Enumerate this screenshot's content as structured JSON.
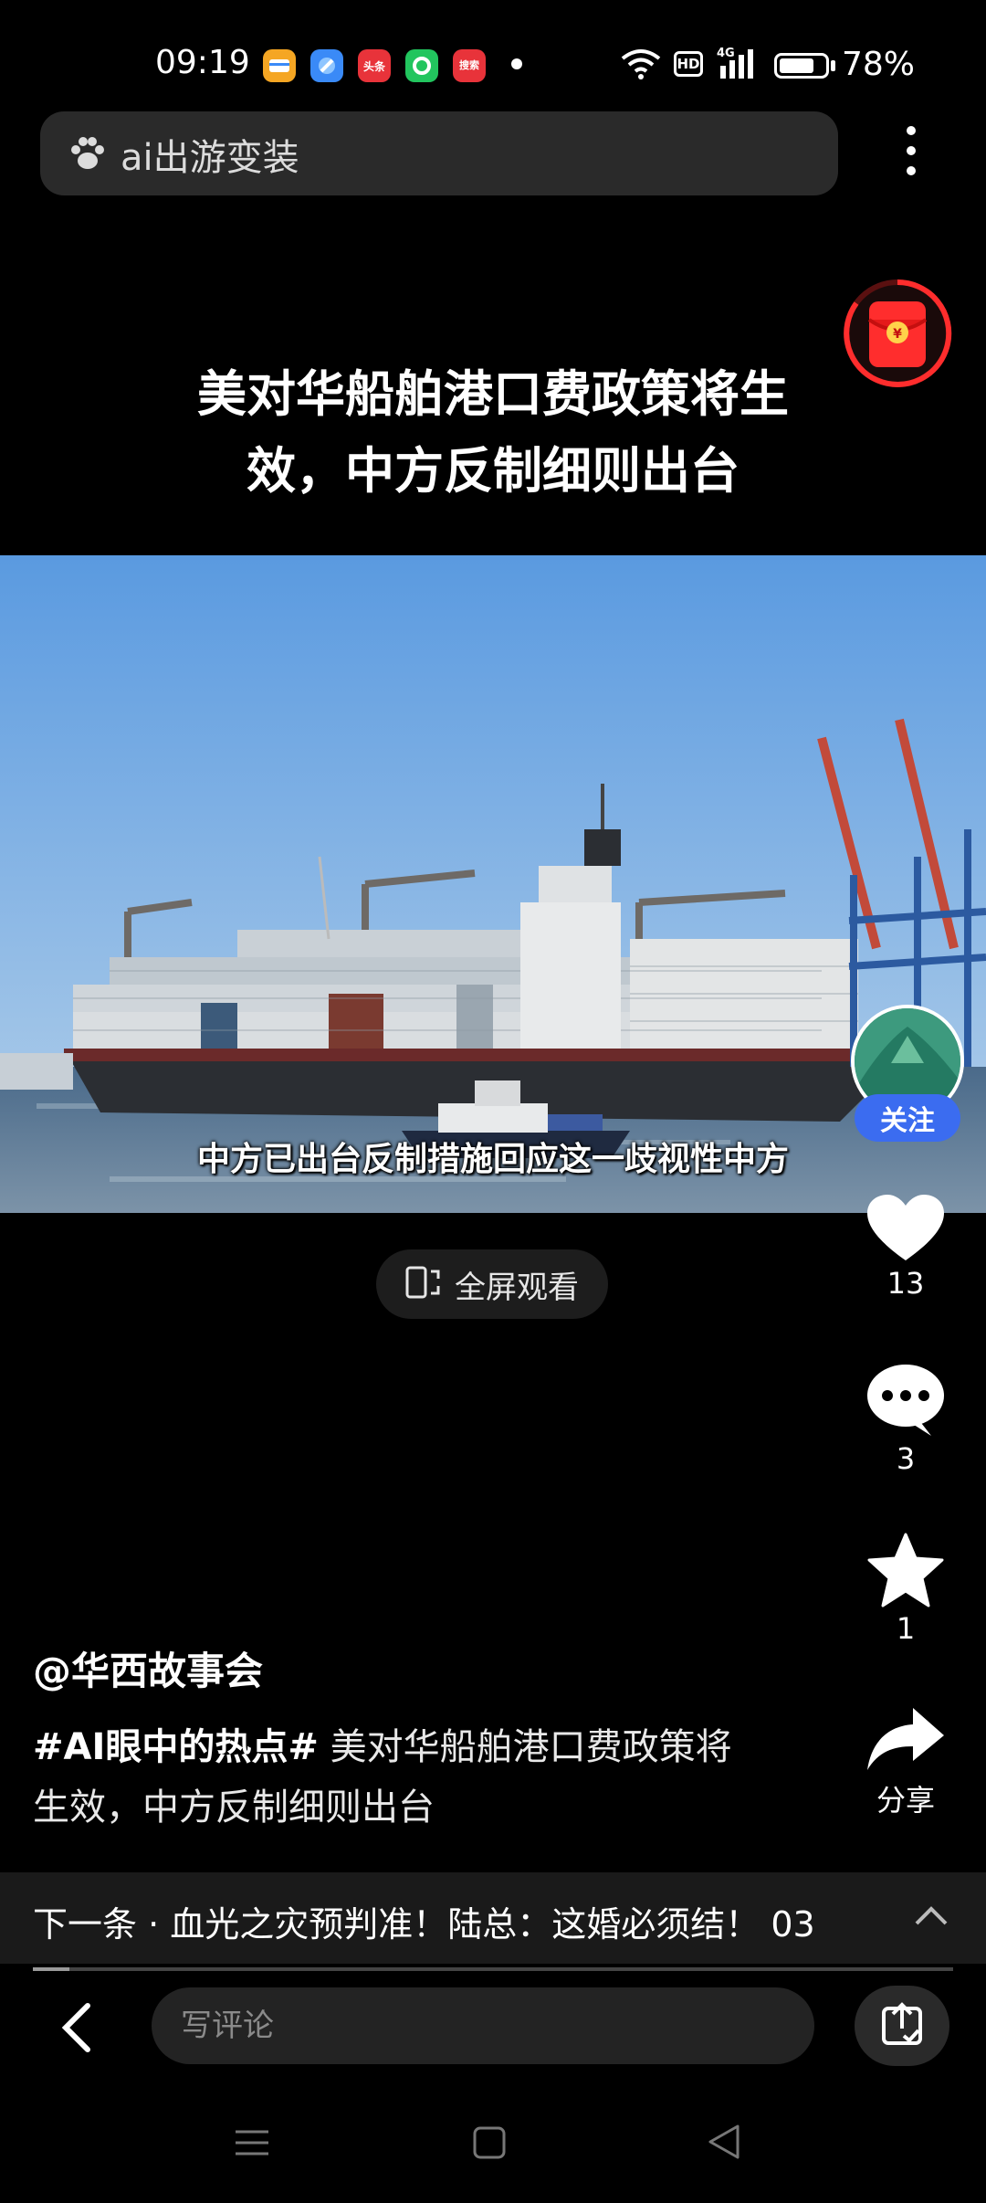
{
  "status_bar": {
    "time": "09:19",
    "apps": [
      {
        "name": "wallet-app-icon",
        "text": "",
        "color": "#f5a623"
      },
      {
        "name": "browser-app-icon",
        "text": "",
        "color": "#3a8af7"
      },
      {
        "name": "toutiao-app-icon",
        "text": "头条",
        "color": "#e8333a"
      },
      {
        "name": "green-app-icon",
        "text": "",
        "color": "#22c55e"
      },
      {
        "name": "news-app-icon",
        "text": "搜索",
        "color": "#e8333a"
      }
    ],
    "network": "4G",
    "hd": "HD",
    "battery_percent": "78%",
    "battery_level": 0.78
  },
  "search": {
    "query": "ai出游变装"
  },
  "video": {
    "title_line1": "美对华船舶港口费政策将生",
    "title_line2": "效，中方反制细则出台",
    "subtitle": "中方已出台反制措施回应这一歧视性中方",
    "fullscreen_label": "全屏观看"
  },
  "sidebar": {
    "follow_label": "关注",
    "like_count": "13",
    "comment_count": "3",
    "favorite_count": "1",
    "share_label": "分享"
  },
  "post": {
    "author": "@华西故事会",
    "hashtag": "#AI眼中的热点#",
    "description": " 美对华船舶港口费政策将生效，中方反制细则出台"
  },
  "next": {
    "text": "下一条 · 血光之灾预判准！陆总：这婚必须结！ 03"
  },
  "progress": 0.04,
  "comment": {
    "placeholder": "写评论"
  },
  "colors": {
    "accent": "#3b6cf0",
    "background": "#000000"
  }
}
